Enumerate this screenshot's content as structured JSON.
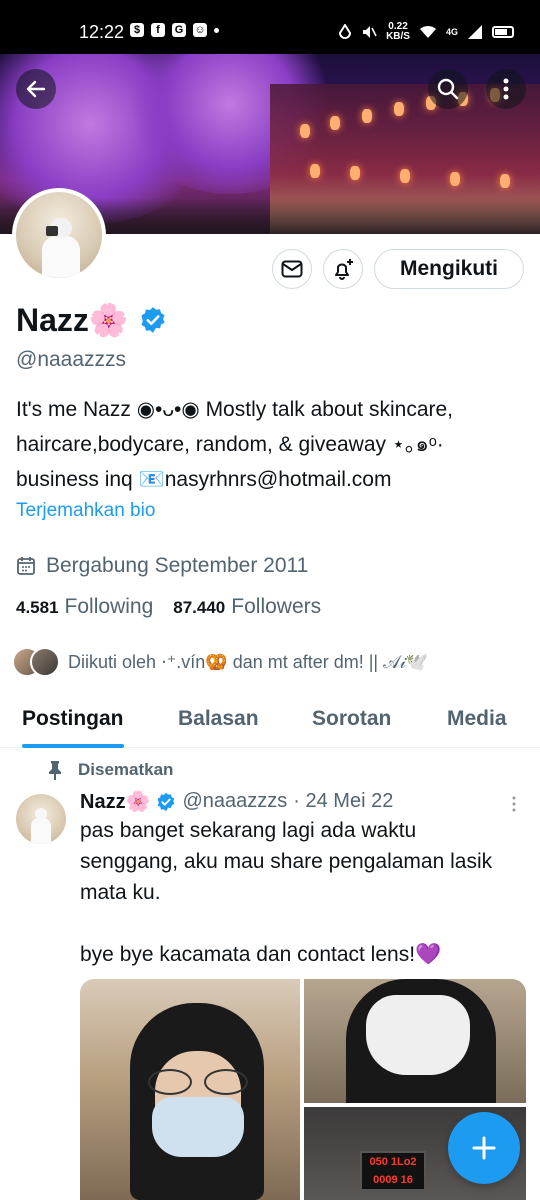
{
  "status_bar": {
    "time": "12:22",
    "net_speed_value": "0.22",
    "net_speed_unit": "KB/S",
    "network_label": "4G"
  },
  "profile": {
    "name": "Nazz",
    "name_emoji": "🌸",
    "handle": "@naaazzzs",
    "bio_lines": [
      "It's me Nazz ◉•ᴗ•◉ Mostly talk about skincare,",
      "haircare,bodycare, random, & giveaway ⋆｡๑ᵒ·",
      "business inq 📧nasyrhnrs@hotmail.com"
    ],
    "translate_link": "Terjemahkan bio",
    "joined": "Bergabung September 2011",
    "following_count": "4.581",
    "following_label": "Following",
    "followers_count": "87.440",
    "followers_label": "Followers",
    "followed_by": "Diikuti oleh ⋅⁺.vín🥨 dan mt after dm! || 𝒜𝒾🕊️"
  },
  "actions": {
    "follow_label": "Mengikuti"
  },
  "tabs": [
    {
      "label": "Postingan",
      "active": true
    },
    {
      "label": "Balasan",
      "active": false
    },
    {
      "label": "Sorotan",
      "active": false
    },
    {
      "label": "Media",
      "active": false
    }
  ],
  "tweet": {
    "pinned_label": "Disematkan",
    "author": "Nazz",
    "author_emoji": "🌸",
    "handle": "@naaazzzs",
    "date": "· 24 Mei 22",
    "text": "pas banget sekarang lagi ada waktu senggang, aku mau share pengalaman lasik mata ku.\n\nbye bye kacamata dan contact lens!💜",
    "board_text_top": "050  1Lo2",
    "board_text_bottom": "0009   16"
  },
  "colors": {
    "accent": "#1d9bf0",
    "text_primary": "#0f1419",
    "text_secondary": "#536471",
    "border": "#cfd9de"
  },
  "icons": {
    "back": "arrow-left-icon",
    "search": "search-icon",
    "more": "more-vertical-icon",
    "message": "envelope-icon",
    "notify": "bell-plus-icon",
    "verified": "verified-badge-icon",
    "calendar": "calendar-icon",
    "pin": "pin-icon",
    "compose": "plus-icon"
  }
}
